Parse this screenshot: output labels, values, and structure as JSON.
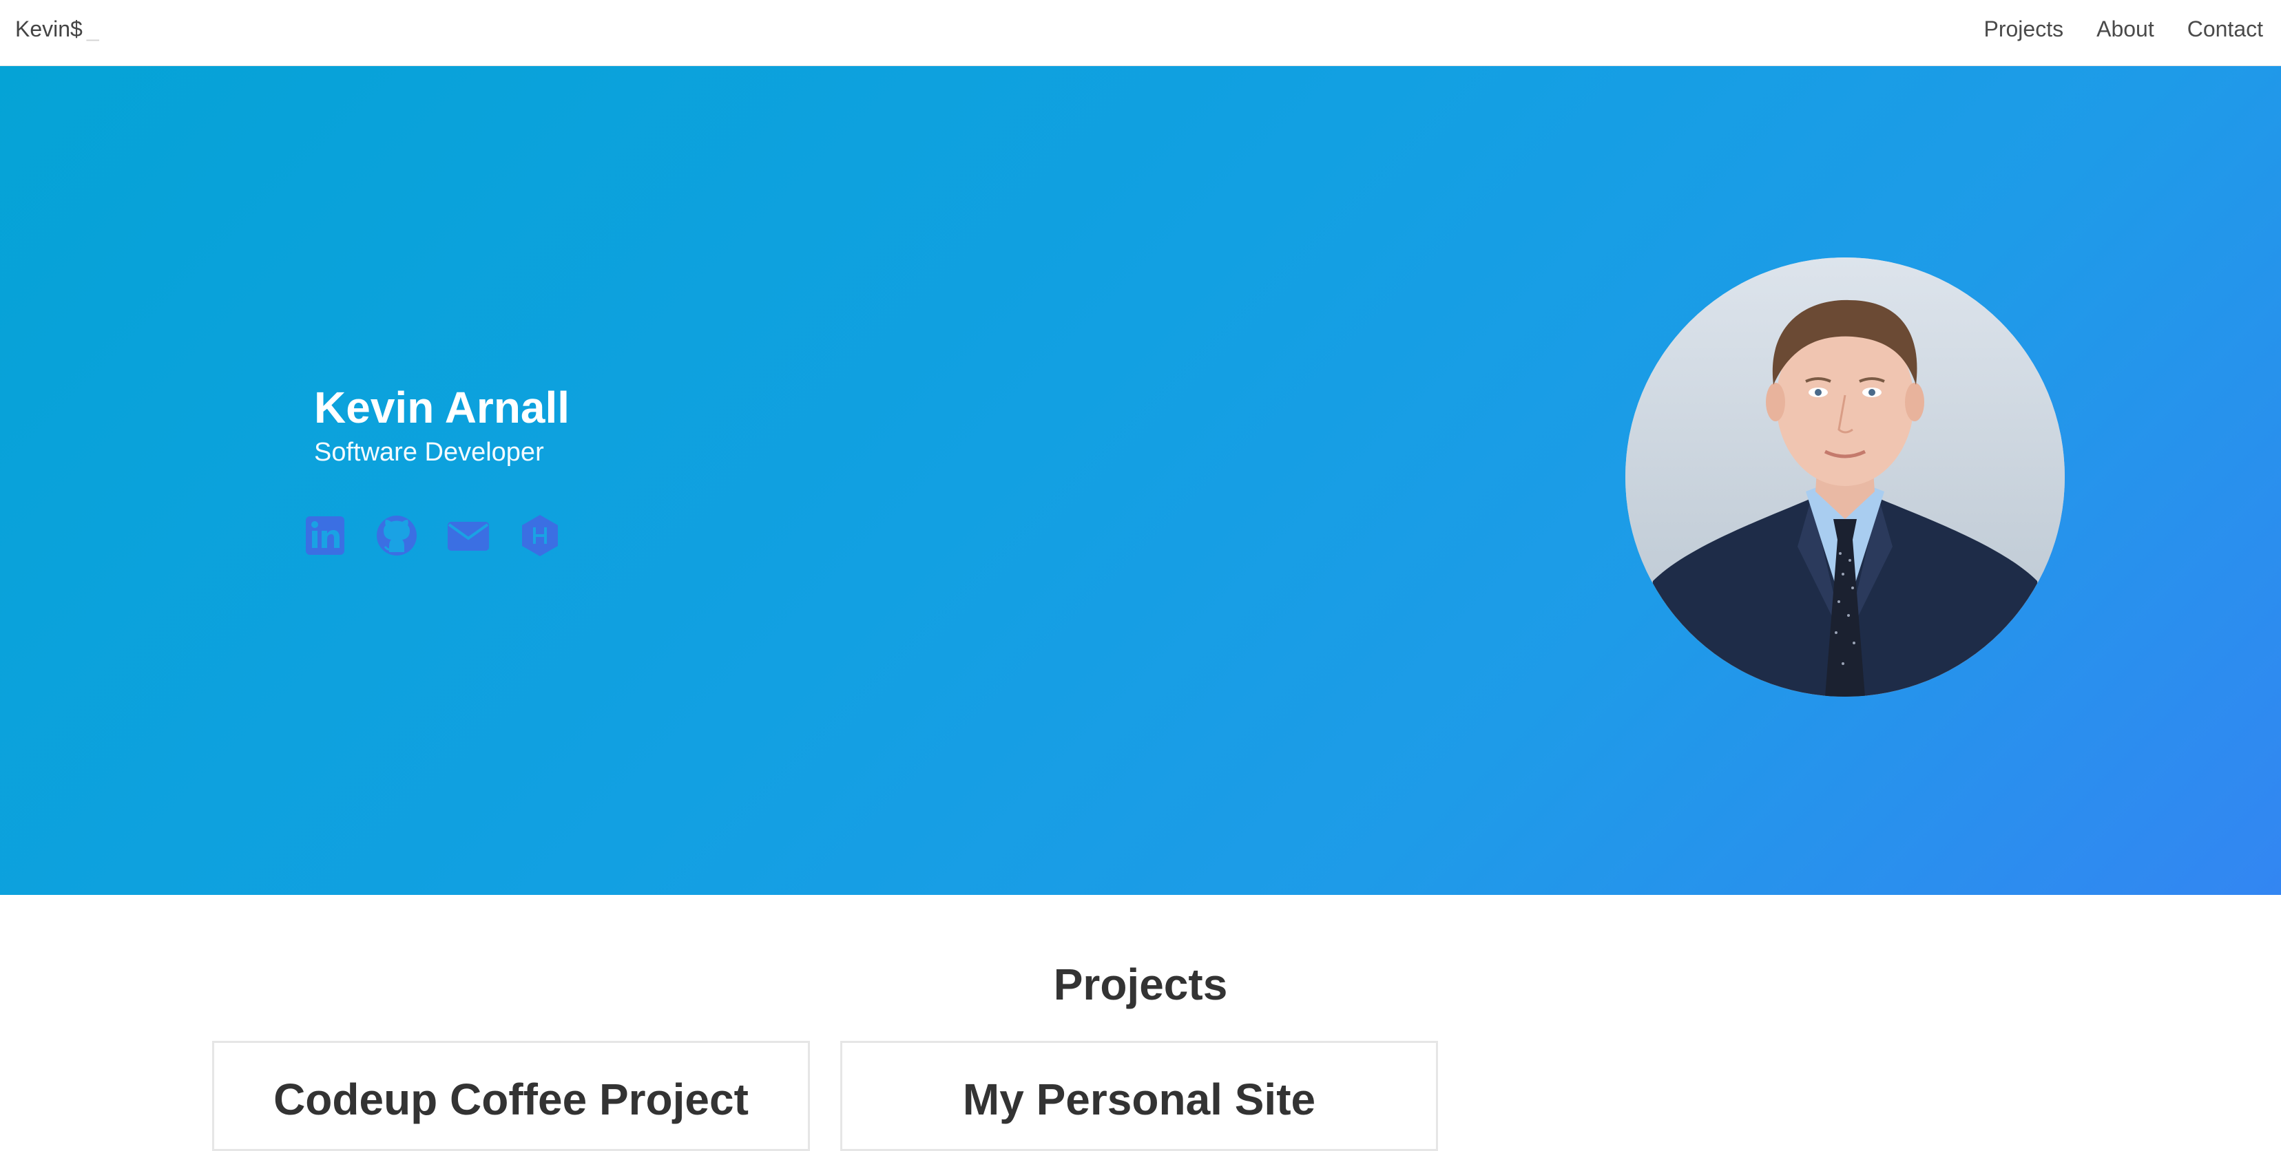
{
  "navbar": {
    "brand": "Kevin$",
    "brand_cursor": "_",
    "links": [
      {
        "label": "Projects"
      },
      {
        "label": "About"
      },
      {
        "label": "Contact"
      }
    ]
  },
  "hero": {
    "name": "Kevin Arnall",
    "subtitle": "Software Developer",
    "social_icons": [
      "linkedin-icon",
      "github-icon",
      "email-icon",
      "hackerrank-icon"
    ],
    "colors": {
      "gradient_start": "#05a3d6",
      "gradient_end": "#3386f2",
      "icon_color": "#3b6fe3"
    }
  },
  "projects": {
    "heading": "Projects",
    "cards": [
      {
        "title": "Codeup Coffee Project"
      },
      {
        "title": "My Personal Site"
      }
    ]
  }
}
